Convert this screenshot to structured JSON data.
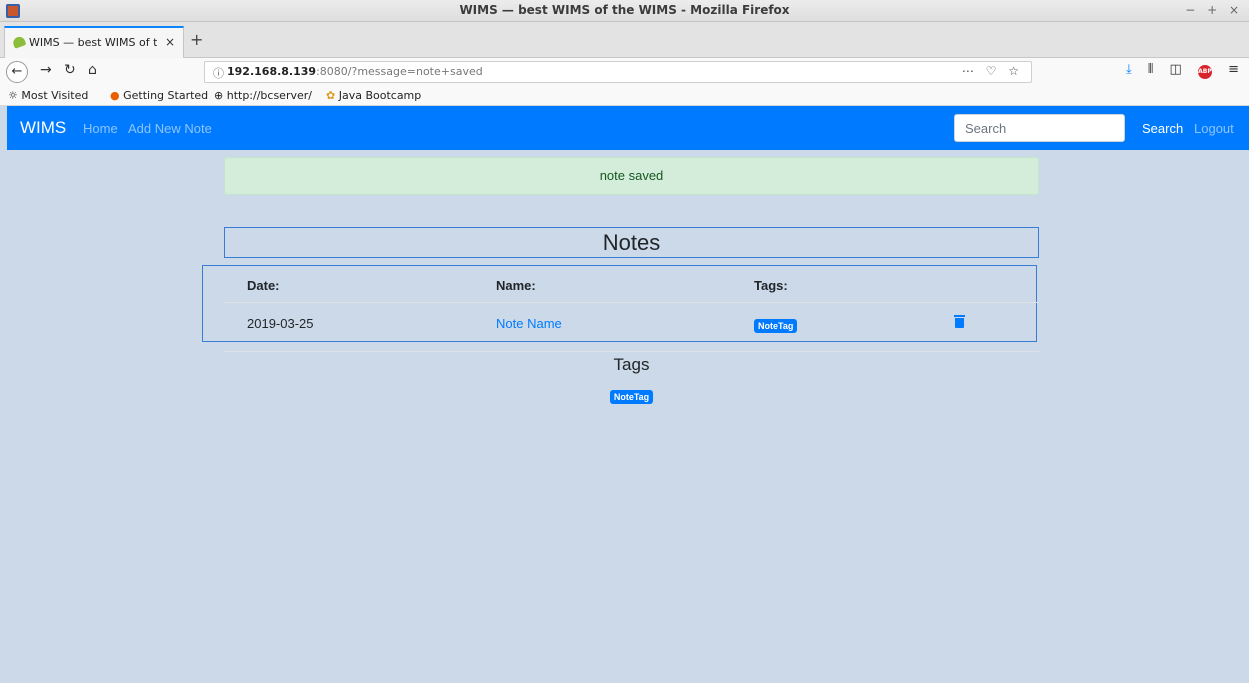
{
  "window": {
    "title": "WIMS — best WIMS of the WIMS - Mozilla Firefox",
    "controls": "− + ×"
  },
  "browser": {
    "tab_title": "WIMS — best WIMS of th",
    "tab_close": "×",
    "new_tab": "+",
    "url_host": "192.168.8.139",
    "url_rest": ":8080/?message=note+saved",
    "url_actions": "⋯ ♡ ☆",
    "bookmarks": [
      {
        "icon": "☼",
        "label": "Most Visited"
      },
      {
        "icon": "●",
        "label": "Getting Started"
      },
      {
        "icon": "⊕",
        "label": "http://bcserver/"
      },
      {
        "icon": "✿",
        "label": "Java Bootcamp"
      }
    ]
  },
  "app": {
    "brand": "WIMS",
    "nav": {
      "home": "Home",
      "add_note": "Add New Note"
    },
    "search": {
      "placeholder": "Search",
      "button": "Search"
    },
    "logout": "Logout"
  },
  "alert": {
    "message": "note saved",
    "color": "#d4edda"
  },
  "notes": {
    "title": "Notes",
    "columns": [
      "Date:",
      "Name:",
      "Tags:"
    ],
    "rows": [
      {
        "date": "2019-03-25",
        "name": "Note Name",
        "tag": "NoteTag"
      }
    ]
  },
  "tags": {
    "title": "Tags",
    "items": [
      "NoteTag"
    ]
  },
  "colors": {
    "primary": "#007bff",
    "page_bg": "#ccd9e8"
  }
}
